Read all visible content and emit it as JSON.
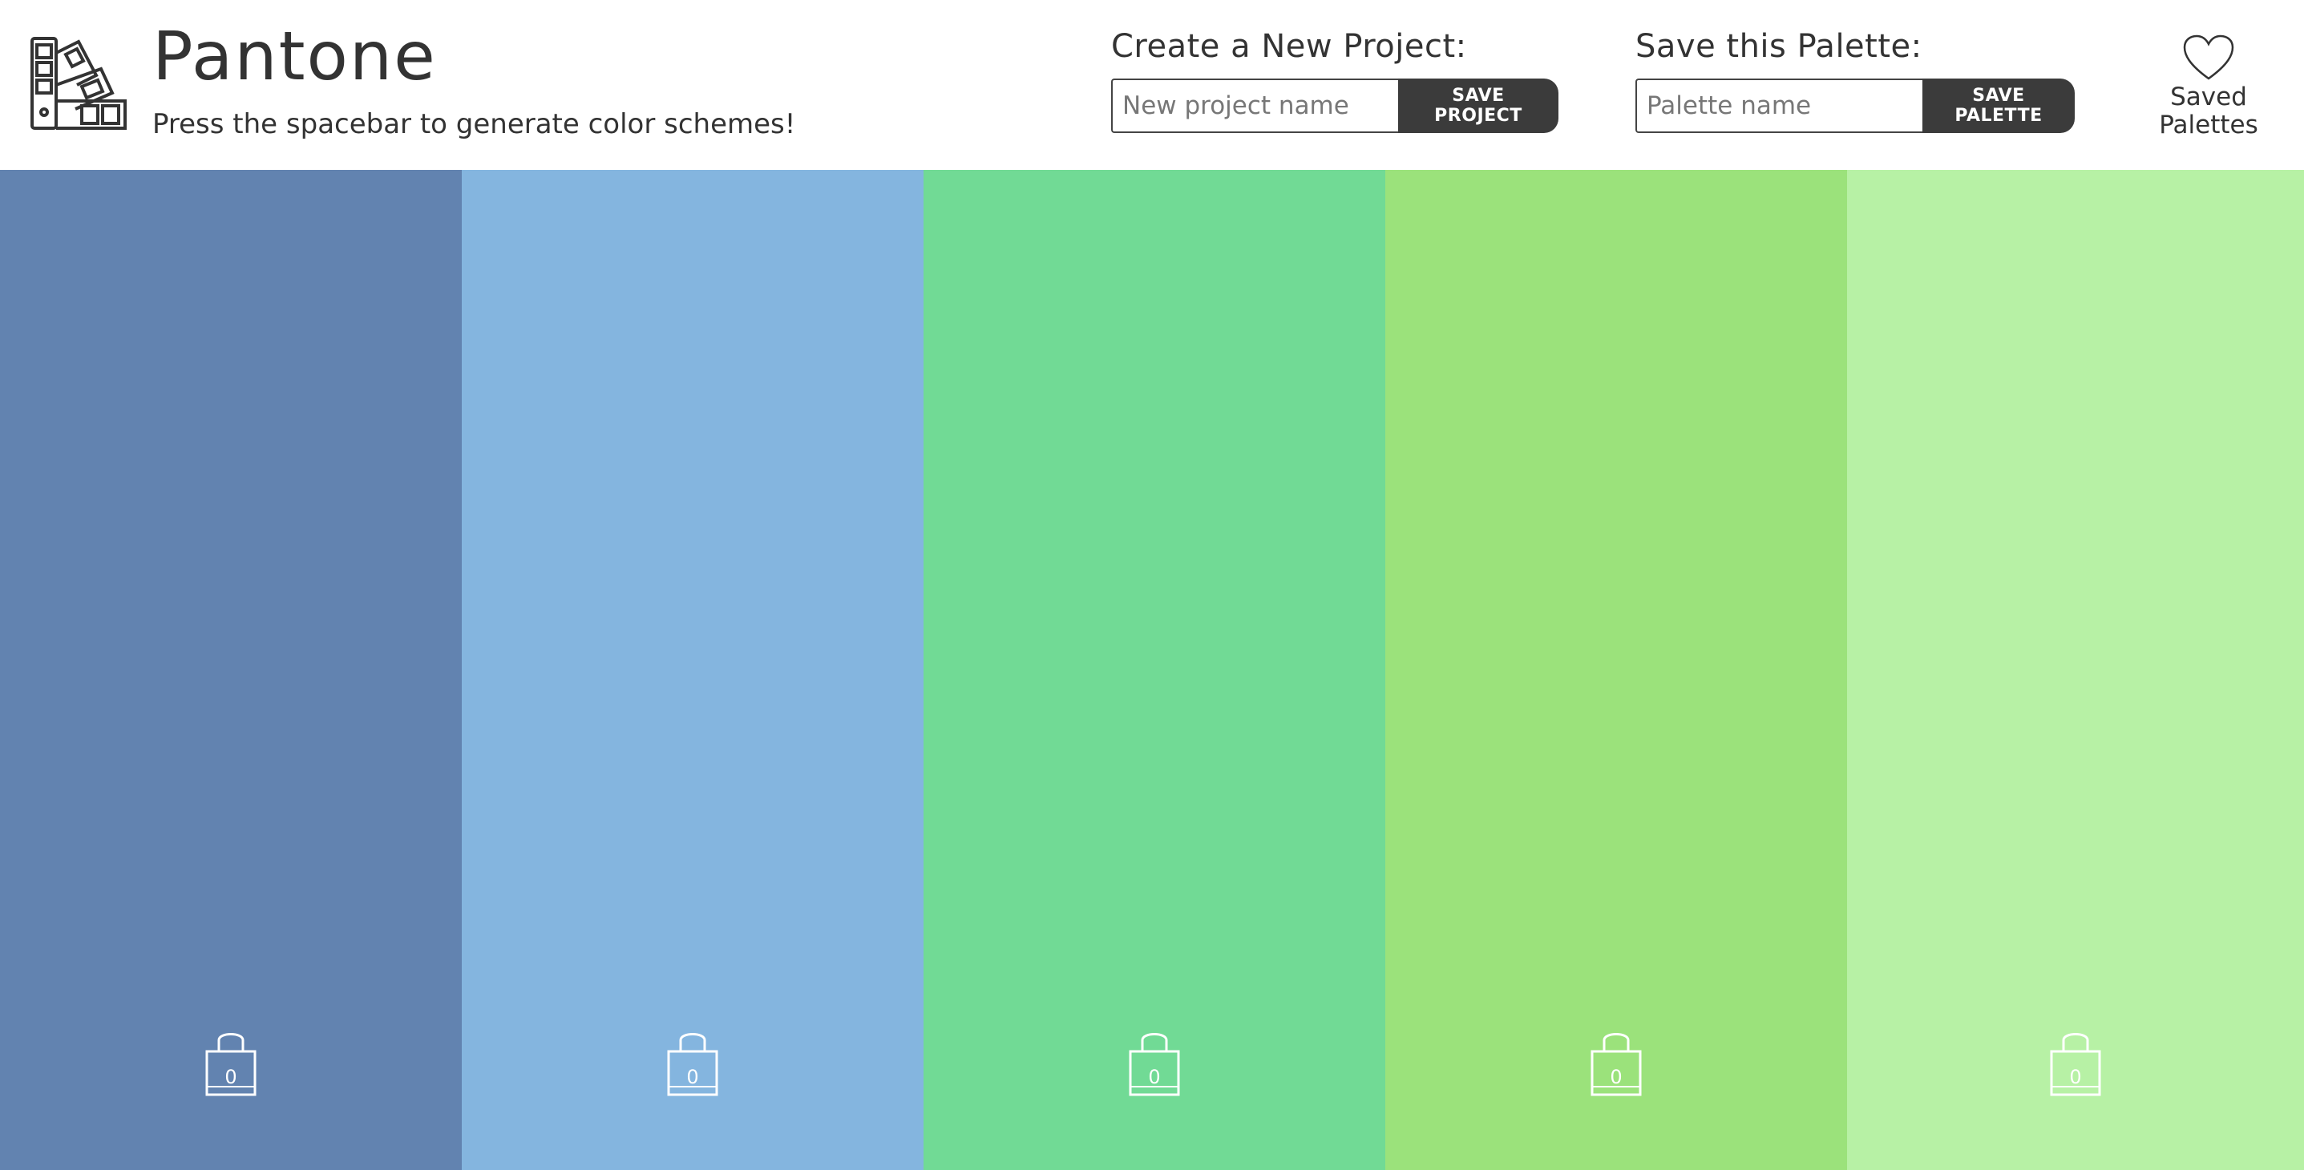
{
  "app": {
    "title": "Pantone",
    "subtitle": "Press the spacebar to generate color schemes!"
  },
  "project_form": {
    "label": "Create a New Project:",
    "placeholder": "New project name",
    "button_label": "SAVE PROJECT"
  },
  "palette_form": {
    "label": "Save this Palette:",
    "placeholder": "Palette name",
    "button_label": "SAVE PALETTE"
  },
  "saved": {
    "icon": "heart-icon",
    "line1": "Saved",
    "line2": "Palettes"
  },
  "swatches": [
    {
      "color": "#6283B0",
      "lock_count": "0",
      "icon": "unlocked-padlock-icon"
    },
    {
      "color": "#84B5DF",
      "lock_count": "0",
      "icon": "unlocked-padlock-icon"
    },
    {
      "color": "#71DA95",
      "lock_count": "0",
      "icon": "unlocked-padlock-icon"
    },
    {
      "color": "#9BE27B",
      "lock_count": "0",
      "icon": "unlocked-padlock-icon"
    },
    {
      "color": "#B7F1A5",
      "lock_count": "0",
      "icon": "unlocked-padlock-icon"
    }
  ]
}
